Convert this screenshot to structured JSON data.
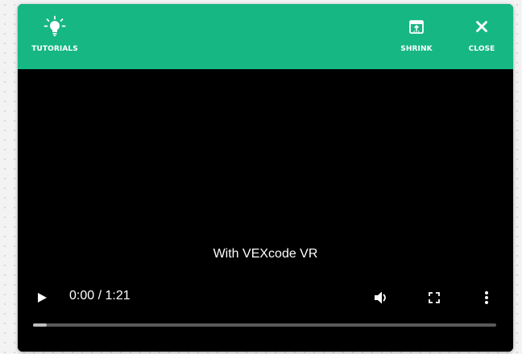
{
  "header": {
    "color": "#16b783",
    "tutorials": {
      "label": "TUTORIALS",
      "icon": "lightbulb-icon"
    },
    "shrink": {
      "label": "SHRINK",
      "icon": "shrink-window-icon"
    },
    "close": {
      "label": "CLOSE",
      "icon": "close-icon"
    }
  },
  "video": {
    "subtitle": "With VEXcode VR",
    "time_display": "0:00 / 1:21",
    "progress": 0.03,
    "controls": {
      "play": "play-icon",
      "volume": "volume-icon",
      "fullscreen": "fullscreen-icon",
      "more": "more-options-icon"
    }
  }
}
